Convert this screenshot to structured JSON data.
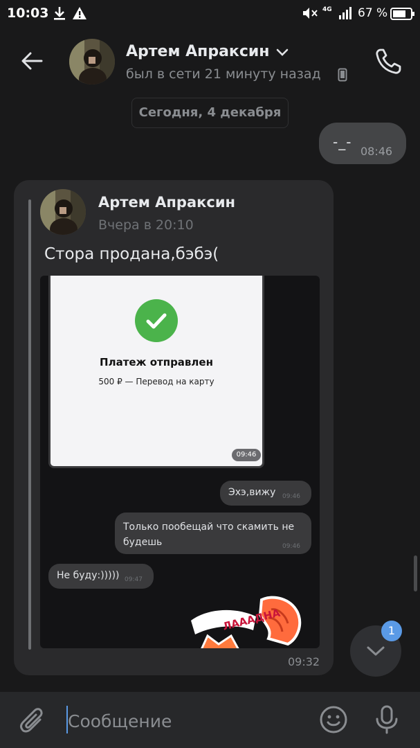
{
  "status_bar": {
    "time": "10:03",
    "network": "4G",
    "battery_percent": "67 %"
  },
  "header": {
    "contact_name": "Артем Апраксин",
    "last_seen": "был в сети 21 минуту назад"
  },
  "date_separator": "Сегодня, 4 декабря",
  "outgoing_message": {
    "text": "-_-",
    "time": "08:46"
  },
  "forwarded_message": {
    "author": "Артем Апраксин",
    "date": "Вчера в 20:10",
    "text": "Стора продана,бэбэ(",
    "time": "09:32",
    "screenshot": {
      "payment_title": "Платеж отправлен",
      "payment_subtitle": "500 ₽ — Перевод на карту",
      "payment_time": "09:46",
      "messages": [
        {
          "text": "Эхэ,вижу",
          "time": "09:46"
        },
        {
          "text_line1": "Только пообещай что скамить не",
          "text_line2": "будешь",
          "time": "09:46"
        },
        {
          "text": "Не буду:)))))",
          "time": "09:47"
        }
      ],
      "sticker_text": "ЛАААДНА"
    }
  },
  "unread_badge": "1",
  "composer": {
    "placeholder": "Сообщение"
  },
  "colors": {
    "accent": "#5a9ae6",
    "success": "#4bb34b",
    "background": "#19191a"
  }
}
